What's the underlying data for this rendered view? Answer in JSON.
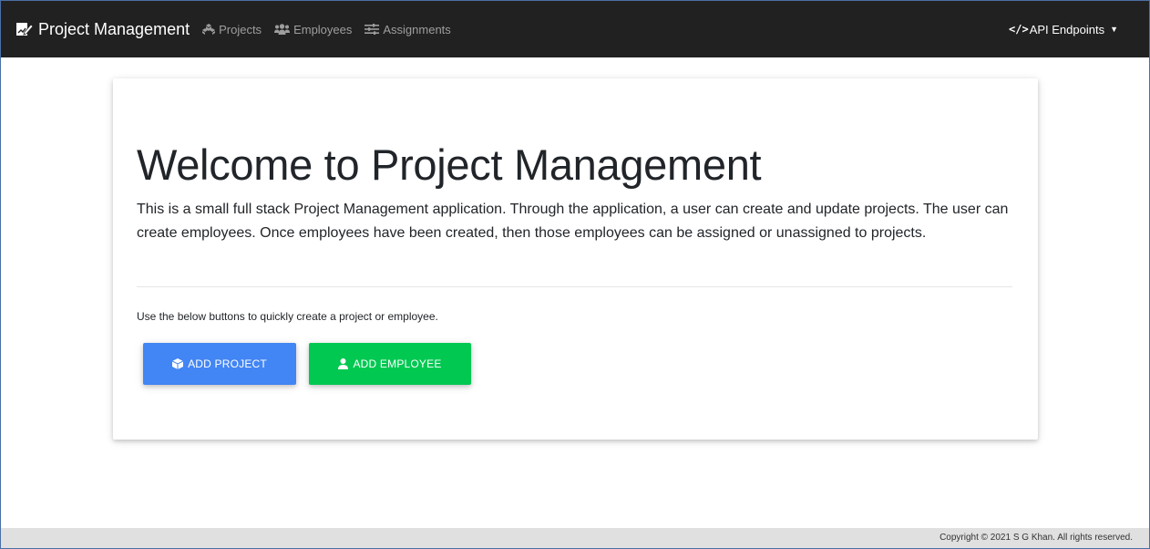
{
  "navbar": {
    "brand": "Project Management",
    "brand_icon": "project-edit-icon",
    "links": [
      {
        "label": "Projects",
        "icon": "cubes-icon"
      },
      {
        "label": "Employees",
        "icon": "users-icon"
      },
      {
        "label": "Assignments",
        "icon": "sliders-icon"
      }
    ],
    "api_menu": {
      "label": "API Endpoints",
      "icon": "code-icon"
    },
    "background": "#212121"
  },
  "main": {
    "title": "Welcome to Project Management",
    "lead": "This is a small full stack Project Management application. Through the application, a user can create and update projects. The user can create employees. Once employees have been created, then those employees can be assigned or unassigned to projects.",
    "hint": "Use the below buttons to quickly create a project or employee.",
    "buttons": {
      "add_project": {
        "label": "ADD PROJECT",
        "icon": "cube-icon",
        "color": "#4285f4"
      },
      "add_employee": {
        "label": "ADD EMPLOYEE",
        "icon": "user-icon",
        "color": "#00c851"
      }
    }
  },
  "footer": {
    "text": "Copyright © 2021 S G Khan. All rights reserved."
  }
}
